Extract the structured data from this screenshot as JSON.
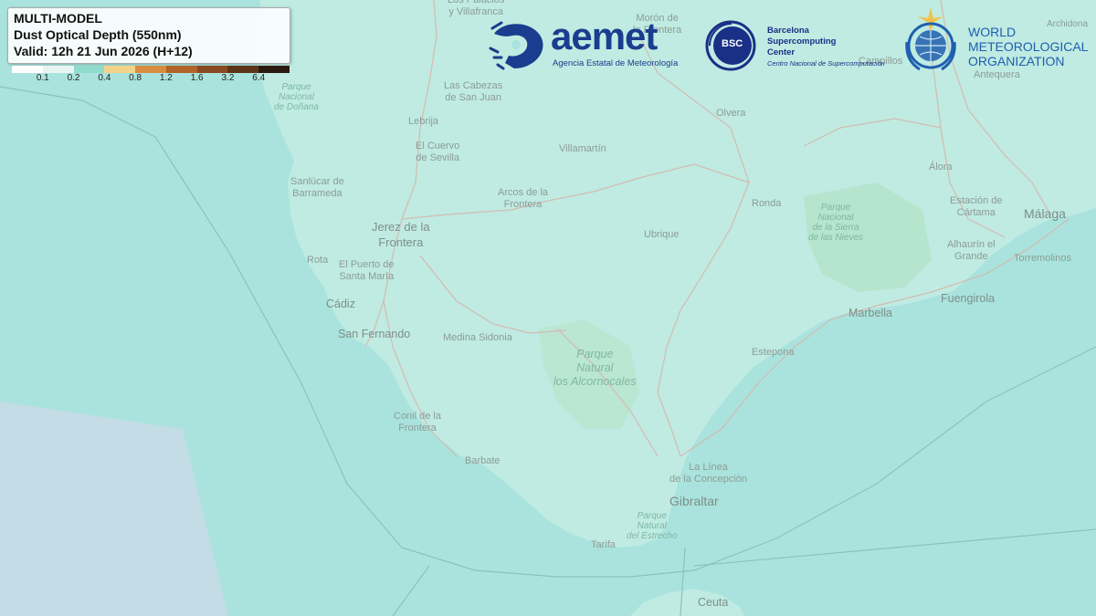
{
  "legend": {
    "title_line1": "MULTI-MODEL",
    "title_line2": "Dust Optical Depth (550nm)",
    "title_line3": "Valid: 12h 21 Jun 2026 (H+12)",
    "colors": [
      "#ffffff",
      "#e8f4f1",
      "#8fdccc",
      "#f2d38a",
      "#d98c3e",
      "#b2632a",
      "#8a4a22",
      "#5e3419",
      "#2a1a10"
    ],
    "ticks": [
      "0.1",
      "0.2",
      "0.4",
      "0.8",
      "1.2",
      "1.6",
      "3.2",
      "6.4"
    ]
  },
  "logos": {
    "aemet_name": "aemet",
    "aemet_sub": "Agencia Estatal de Meteorología",
    "bsc_badge": "BSC",
    "bsc_line1": "Barcelona",
    "bsc_line2": "Supercomputing",
    "bsc_line3": "Center",
    "bsc_sub": "Centro Nacional de Supercomputación",
    "wmo_line1": "WORLD",
    "wmo_line2": "METEOROLOGICAL",
    "wmo_line3": "ORGANIZATION",
    "aemet_icon": "spain-map-icon",
    "wmo_icon": "wmo-emblem-icon"
  },
  "places": {
    "los_palacios": "Los Palacios\ny Villafranca",
    "moron": "Morón de\nla Frontera",
    "archidona": "Archidona",
    "parque_donana": "Parque\nNacional\nde Doñana",
    "las_cabezas": "Las Cabezas\nde San Juan",
    "campillos": "Campillos",
    "antequera": "Antequera",
    "lebrija": "Lebrija",
    "olvera": "Olvera",
    "el_cuervo": "El Cuervo\nde Sevilla",
    "villamartin": "Villamartín",
    "alora": "Álora",
    "sanlucar": "Sanlúcar de\nBarrameda",
    "arcos": "Arcos de la\nFrontera",
    "ronda": "Ronda",
    "estacion_cartama": "Estación de\nCártama",
    "malaga": "Málaga",
    "jerez": "Jerez de la\nFrontera",
    "ubrique": "Ubrique",
    "parque_nieves": "Parque\nNacional\nde la Sierra\nde las Nieves",
    "alhaurin": "Alhaurín el\nGrande",
    "torremolinos": "Torremolinos",
    "rota": "Rota",
    "puerto_sm": "El Puerto de\nSanta María",
    "fuengirola": "Fuengirola",
    "cadiz": "Cádiz",
    "marbella": "Marbella",
    "san_fernando": "San Fernando",
    "medina": "Medina Sidonia",
    "estepona": "Estepona",
    "parque_alcornocales": "Parque\nNatural\nlos Alcornocales",
    "conil": "Conil de la\nFrontera",
    "barbate": "Barbate",
    "la_linea": "La Línea\nde la Concepción",
    "gibraltar": "Gibraltar",
    "parque_estrecho": "Parque\nNatural\ndel Estrecho",
    "tarifa": "Tarifa",
    "ceuta": "Ceuta"
  }
}
